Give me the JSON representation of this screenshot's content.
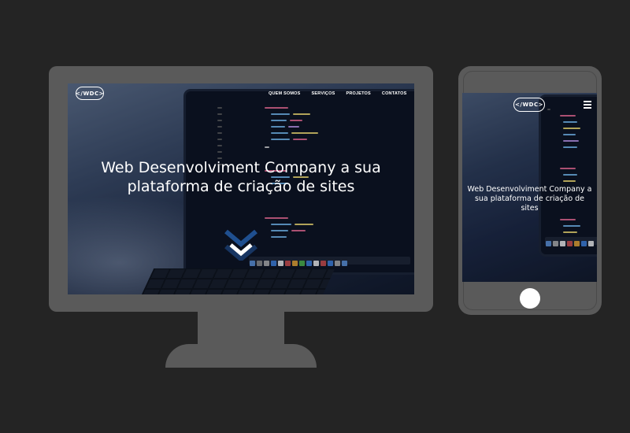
{
  "desktop": {
    "logo_text": "</WDC>",
    "nav": [
      {
        "label": "QUEM SOMOS"
      },
      {
        "label": "SERVIÇOS"
      },
      {
        "label": "PROJETOS"
      },
      {
        "label": "CONTATOS"
      }
    ],
    "hero_line1": "Web Desenvolviment Company a sua",
    "hero_line2": "plataforma de criação de sites",
    "scroll_icon": "double-chevron-down-icon"
  },
  "mobile": {
    "logo_text": "</WDC>",
    "menu_icon": "hamburger-menu-icon",
    "hero_line1": "Web Desenvolviment Company a",
    "hero_line2": "sua plataforma de criação de",
    "hero_line3": "sites"
  },
  "colors": {
    "page_background": "#242424",
    "device_frame": "#5a5a5a",
    "text": "#ffffff",
    "chevron_primary": "#ffffff",
    "chevron_secondary": "#1f4f8f"
  }
}
